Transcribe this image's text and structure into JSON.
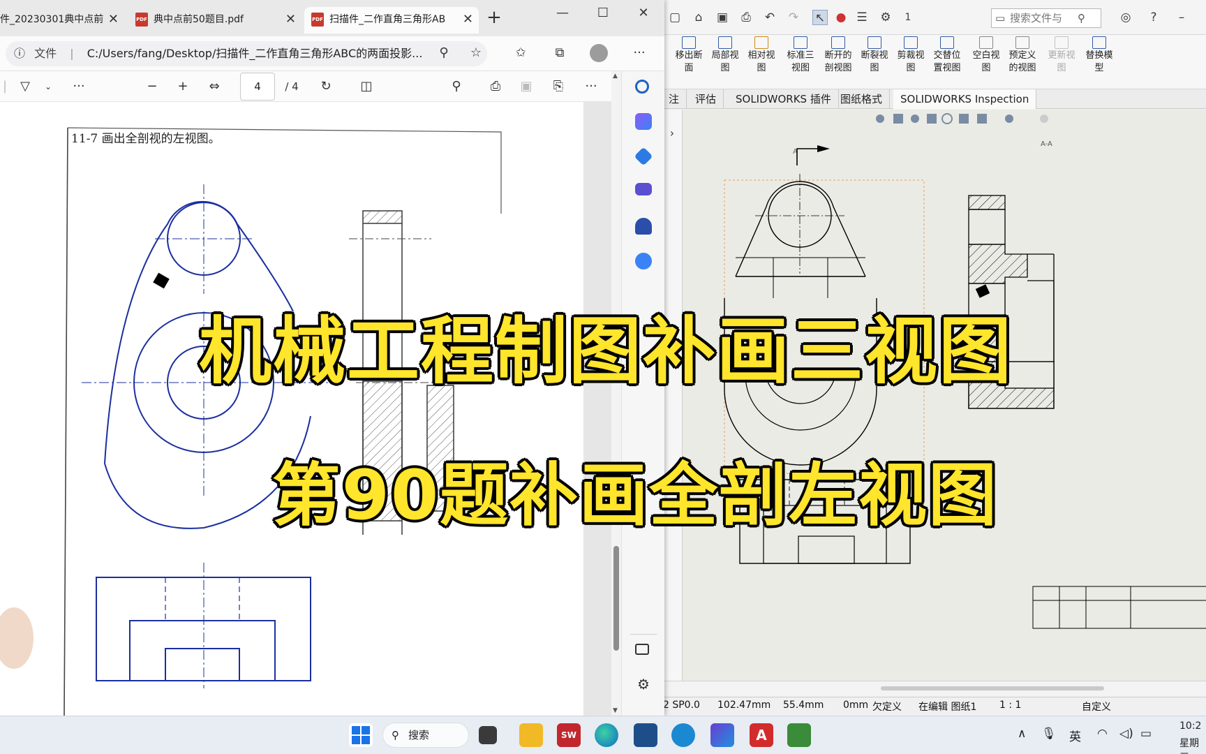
{
  "edge": {
    "tabs": [
      {
        "label": "件_20230301典中点前"
      },
      {
        "label": "典中点前50题目.pdf"
      },
      {
        "label": "扫描件_二作直角三角形AB"
      }
    ],
    "address": {
      "label": "文件",
      "url": "C:/Users/fang/Desktop/扫描件_二作直角三角形ABC的两面投影..."
    },
    "pdf_toolbar": {
      "page_current": "4",
      "page_total": "/ 4",
      "minus": "−",
      "plus": "+",
      "more": "···"
    },
    "pdf_page": {
      "problem_text": "11-7  画出全剖视的左视图。"
    }
  },
  "solidworks": {
    "search_placeholder": "搜索文件与",
    "qat_number": "1",
    "ribbon": [
      {
        "label": "移出断\n面"
      },
      {
        "label": "局部视\n图"
      },
      {
        "label": "相对视\n图"
      },
      {
        "label": "标准三\n视图"
      },
      {
        "label": "断开的\n剖视图"
      },
      {
        "label": "断裂视\n图"
      },
      {
        "label": "剪裁视\n图"
      },
      {
        "label": "交替位\n置视图"
      },
      {
        "label": "空白视\n图"
      },
      {
        "label": "预定义\n的视图"
      },
      {
        "label": "更新视\n图"
      },
      {
        "label": "替换模\n型"
      }
    ],
    "tabs": [
      {
        "label": "注"
      },
      {
        "label": "评估"
      },
      {
        "label": "SOLIDWORKS 插件"
      },
      {
        "label": "图纸格式"
      },
      {
        "label": "SOLIDWORKS Inspection"
      }
    ],
    "drawing": {
      "section_label": "A-A",
      "arrow_label": "A"
    },
    "status": {
      "version": "2 SP0.0",
      "x": "102.47mm",
      "y": "55.4mm",
      "z": "0mm",
      "state": "欠定义",
      "editing": "在编辑 图纸1",
      "scale": "1 : 1",
      "custom": "自定义"
    }
  },
  "overlay": {
    "line1": "机械工程制图补画三视图",
    "line2": "第90题补画全剖左视图"
  },
  "taskbar": {
    "search_label": "搜索",
    "ime": "英",
    "time": "10:2",
    "date": "星期三"
  },
  "colors": {
    "headline_fill": "#ffe52b",
    "drawing_blue": "#1b2f9e",
    "edge_tab_bg": "#e9e9ea"
  }
}
